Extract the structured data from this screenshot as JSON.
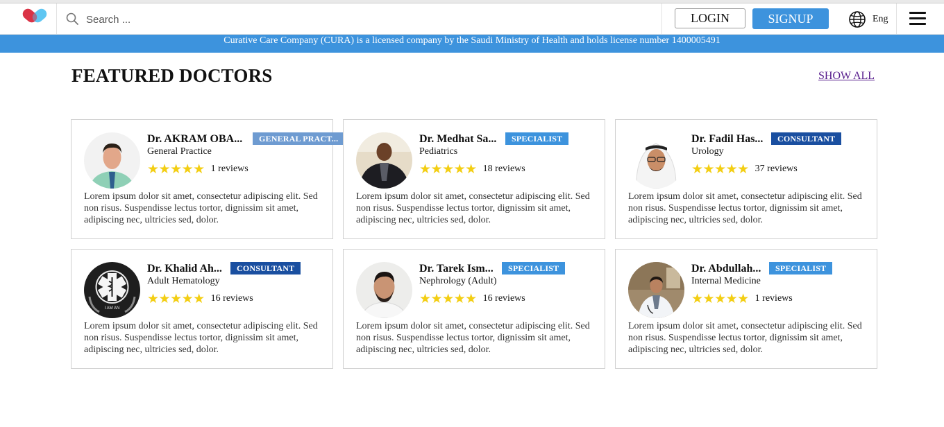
{
  "header": {
    "search_placeholder": "Search ...",
    "login_label": "LOGIN",
    "signup_label": "SIGNUP",
    "language": "Eng"
  },
  "banner": {
    "text": "Curative Care Company (CURA) is a licensed company by the Saudi Ministry of Health and holds license number 1400005491"
  },
  "section": {
    "title": "FEATURED DOCTORS",
    "show_all": "SHOW ALL"
  },
  "doctors": [
    {
      "name": "Dr. AKRAM OBA...",
      "badge": "GENERAL PRACT...",
      "specialty": "General Practice",
      "stars": "★★★★★",
      "reviews": "1 reviews",
      "description": "Lorem ipsum dolor sit amet, consectetur adipiscing elit. Sed non risus. Suspendisse lectus tortor, dignissim sit amet, adipiscing nec, ultricies sed, dolor."
    },
    {
      "name": "Dr. Medhat Sa...",
      "badge": "SPECIALIST",
      "specialty": "Pediatrics",
      "stars": "★★★★★",
      "reviews": "18 reviews",
      "description": "Lorem ipsum dolor sit amet, consectetur adipiscing elit. Sed non risus. Suspendisse lectus tortor, dignissim sit amet, adipiscing nec, ultricies sed, dolor."
    },
    {
      "name": "Dr. Fadil Has...",
      "badge": "CONSULTANT",
      "specialty": "Urology",
      "stars": "★★★★★",
      "reviews": "37 reviews",
      "description": "Lorem ipsum dolor sit amet, consectetur adipiscing elit. Sed non risus. Suspendisse lectus tortor, dignissim sit amet, adipiscing nec, ultricies sed, dolor."
    },
    {
      "name": "Dr. Khalid Ah...",
      "badge": "CONSULTANT",
      "specialty": "Adult Hematology",
      "stars": "★★★★★",
      "reviews": "16 reviews",
      "description": "Lorem ipsum dolor sit amet, consectetur adipiscing elit. Sed non risus. Suspendisse lectus tortor, dignissim sit amet, adipiscing nec, ultricies sed, dolor.",
      "avatar_text": "I AM AN"
    },
    {
      "name": "Dr. Tarek Ism...",
      "badge": "SPECIALIST",
      "specialty": "Nephrology (Adult)",
      "stars": "★★★★★",
      "reviews": "16 reviews",
      "description": "Lorem ipsum dolor sit amet, consectetur adipiscing elit. Sed non risus. Suspendisse lectus tortor, dignissim sit amet, adipiscing nec, ultricies sed, dolor."
    },
    {
      "name": "Dr. Abdullah...",
      "badge": "SPECIALIST",
      "specialty": "Internal Medicine",
      "stars": "★★★★★",
      "reviews": "1 reviews",
      "description": "Lorem ipsum dolor sit amet, consectetur adipiscing elit. Sed non risus. Suspendisse lectus tortor, dignissim sit amet, adipiscing nec, ultricies sed, dolor."
    }
  ],
  "colors": {
    "primary": "#3d93dd",
    "consultant_badge": "#1a4fa0",
    "specialist_badge": "#3d93dd",
    "general_badge": "#6e9bd1",
    "star": "#f3ce13",
    "show_all_link": "#551a8b"
  },
  "icons": {
    "logo": "heart-pill-logo",
    "search": "search-icon",
    "language": "globe-icon",
    "menu": "hamburger-menu-icon",
    "rating": "star-icon"
  }
}
